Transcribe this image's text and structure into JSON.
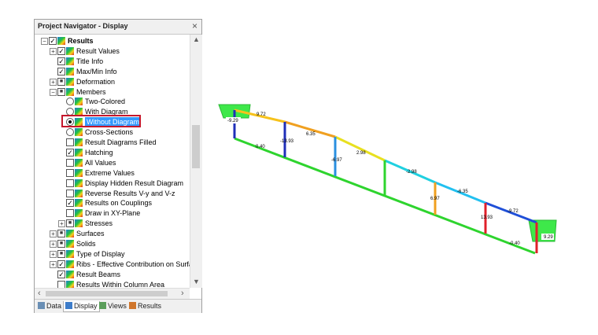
{
  "panel": {
    "title": "Project Navigator - Display",
    "close_glyph": "×",
    "tree": [
      {
        "label": "Results",
        "checked": "✓",
        "expander": "−",
        "bold": true
      },
      {
        "label": "Result Values",
        "checked": "✓",
        "expander": "+"
      },
      {
        "label": "Title Info",
        "checked": "✓"
      },
      {
        "label": "Max/Min Info",
        "checked": "✓"
      },
      {
        "label": "Deformation",
        "checked": "■",
        "expander": "+"
      },
      {
        "label": "Members",
        "checked": "■",
        "expander": "−"
      },
      {
        "label": "Two-Colored",
        "radio": false
      },
      {
        "label": "With Diagram",
        "radio": false
      },
      {
        "label": "Without Diagram",
        "radio": true,
        "selected": true
      },
      {
        "label": "Cross-Sections",
        "radio": false
      },
      {
        "label": "Result Diagrams Filled",
        "checked": ""
      },
      {
        "label": "Hatching",
        "checked": "✓"
      },
      {
        "label": "All Values",
        "checked": ""
      },
      {
        "label": "Extreme Values",
        "checked": ""
      },
      {
        "label": "Display Hidden Result Diagram",
        "checked": ""
      },
      {
        "label": "Reverse Results V-y and V-z",
        "checked": ""
      },
      {
        "label": "Results on Couplings",
        "checked": "✓"
      },
      {
        "label": "Draw in XY-Plane",
        "checked": ""
      },
      {
        "label": "Stresses",
        "checked": "■",
        "expander": "+"
      },
      {
        "label": "Surfaces",
        "checked": "■",
        "expander": "+"
      },
      {
        "label": "Solids",
        "checked": "■",
        "expander": "+"
      },
      {
        "label": "Type of Display",
        "checked": "■",
        "expander": "+"
      },
      {
        "label": "Ribs - Effective Contribution on Surfac",
        "checked": "✓",
        "expander": "+"
      },
      {
        "label": "Result Beams",
        "checked": "✓"
      },
      {
        "label": "Results Within Column Area",
        "checked": ""
      }
    ],
    "scroll": {
      "up": "▲",
      "down": "▼",
      "left": "‹",
      "right": "›"
    },
    "tabs": [
      {
        "label": "Data",
        "active": false,
        "color": "#6a8fb5"
      },
      {
        "label": "Display",
        "active": true,
        "color": "#3d7cc9"
      },
      {
        "label": "Views",
        "active": false,
        "color": "#5a9e5a"
      },
      {
        "label": "Results",
        "active": false,
        "color": "#d0762c"
      }
    ]
  },
  "model": {
    "colors": {
      "red": "#e0202a",
      "blue": "#1f2fb8",
      "green": "#2ed42e",
      "support": "#3ee84a"
    },
    "labels": {
      "left_support": "-9.29",
      "right_support": "9.29",
      "left_end": "0.40",
      "right_end": "-0.40",
      "top_chord": [
        "9.72",
        "6.35",
        "2.98",
        "-2.98",
        "-6.35",
        "-9.72"
      ],
      "verticals": [
        "-13.93",
        "-6.97",
        "6.97",
        "13.93"
      ]
    }
  }
}
